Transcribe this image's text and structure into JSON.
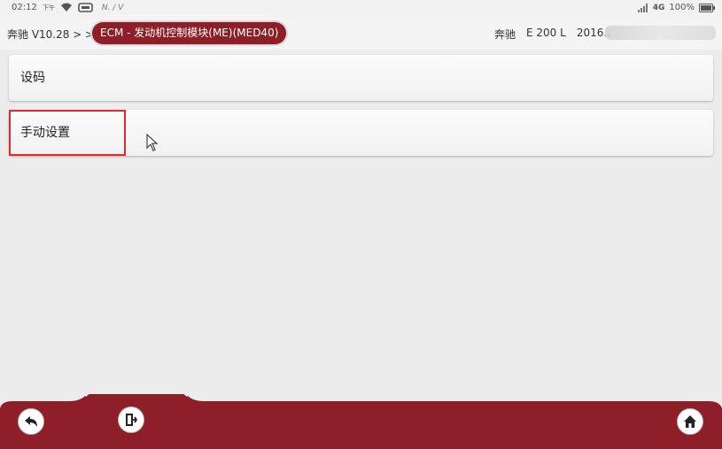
{
  "status_bar": {
    "time": "02:12",
    "ampm": "下午",
    "nv": "N. / V",
    "network": "4G",
    "battery": "100%"
  },
  "header": {
    "breadcrumb_root": "奔驰 V10.28 > >",
    "breadcrumb_current": "ECM - 发动机控制模块(ME)(MED40)",
    "vehicle_make": "奔驰",
    "vehicle_model": "E 200 L",
    "vehicle_year": "2016.."
  },
  "menu": {
    "items": [
      {
        "label": "设码"
      },
      {
        "label": "手动设置"
      }
    ]
  },
  "toolbar": {
    "back_icon": "back-arrow-icon",
    "exit_icon": "exit-door-icon",
    "home_icon": "home-icon",
    "bar_color": "#8e1f28"
  }
}
